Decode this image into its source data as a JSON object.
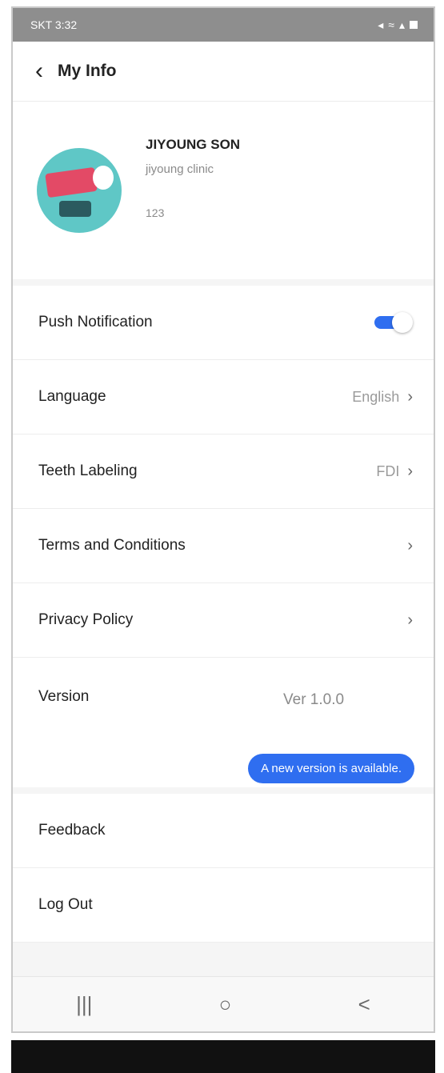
{
  "status": {
    "carrier_time": "SKT 3:32",
    "icons": [
      "mute-icon",
      "wifi-icon",
      "signal-icon",
      "battery-icon"
    ]
  },
  "header": {
    "title": "My Info",
    "back_icon": "chevron-left-icon"
  },
  "profile": {
    "name": "JIYOUNG SON",
    "clinic": "jiyoung clinic",
    "code": "123"
  },
  "settings": {
    "push_label": "Push Notification",
    "push_enabled": true,
    "language_label": "Language",
    "language_value": "English",
    "teeth_label": "Teeth Labeling",
    "teeth_value": "FDI",
    "terms_label": "Terms and Conditions",
    "privacy_label": "Privacy Policy",
    "version_label": "Version",
    "version_value": "Ver 1.0.0",
    "update_notice": "A new version is available.",
    "feedback_label": "Feedback",
    "logout_label": "Log Out"
  },
  "nav": {
    "recent": "|||",
    "home": "○",
    "back": "<"
  },
  "colors": {
    "accent": "#2f6ef0",
    "status_bar": "#8e8e8e"
  }
}
